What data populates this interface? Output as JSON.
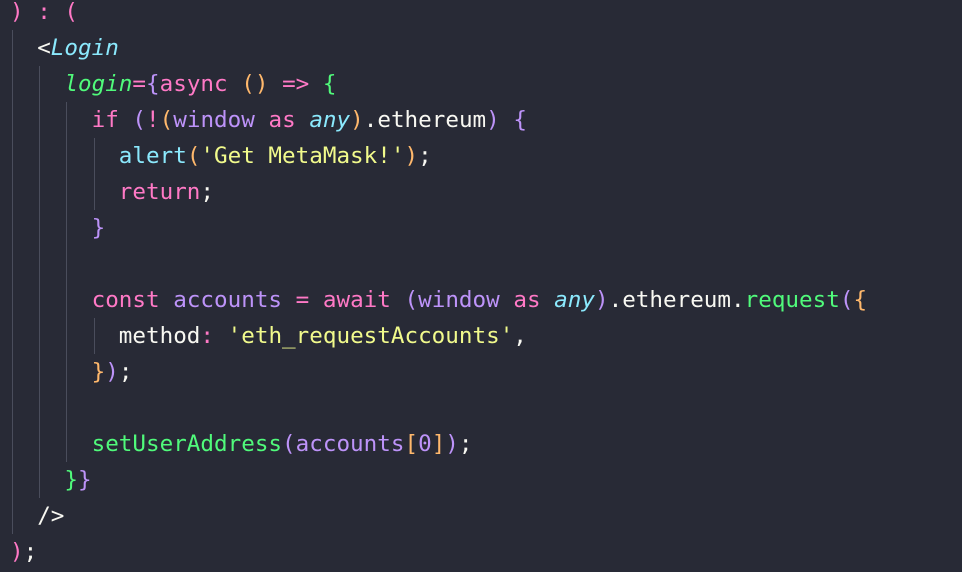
{
  "theme": {
    "background": "#282a36",
    "indent_guide": "#4a4d5c",
    "colors": {
      "punct": "#f8f8f2",
      "keyword": "#ff79c6",
      "identifier": "#bd93f9",
      "component": "#8be9fd",
      "prop": "#50fa7b",
      "function": "#50fa7b",
      "builtin": "#8be9fd",
      "string": "#f1fa8c",
      "paren_pink": "#ff79c6",
      "paren_purple": "#bd93f9",
      "paren_orange": "#ffb86c",
      "paren_green": "#50fa7b",
      "number": "#bd93f9",
      "tag_bracket": "#f8f8f2"
    }
  },
  "code": {
    "lines": [
      {
        "indent": 0,
        "tokens": [
          {
            "t": ") : (",
            "c": "paren_pink"
          }
        ]
      },
      {
        "indent": 1,
        "tokens": [
          {
            "t": "<",
            "c": "tag_bracket"
          },
          {
            "t": "Login",
            "c": "component",
            "i": true
          }
        ]
      },
      {
        "indent": 2,
        "tokens": [
          {
            "t": "login",
            "c": "prop",
            "i": true
          },
          {
            "t": "=",
            "c": "keyword"
          },
          {
            "t": "{",
            "c": "paren_purple"
          },
          {
            "t": "async",
            "c": "keyword"
          },
          {
            "t": " ",
            "c": "punct"
          },
          {
            "t": "()",
            "c": "paren_orange"
          },
          {
            "t": " ",
            "c": "punct"
          },
          {
            "t": "=>",
            "c": "keyword"
          },
          {
            "t": " ",
            "c": "punct"
          },
          {
            "t": "{",
            "c": "paren_green"
          }
        ]
      },
      {
        "indent": 3,
        "tokens": [
          {
            "t": "if",
            "c": "keyword"
          },
          {
            "t": " ",
            "c": "punct"
          },
          {
            "t": "(",
            "c": "paren_purple"
          },
          {
            "t": "!",
            "c": "keyword"
          },
          {
            "t": "(",
            "c": "paren_orange"
          },
          {
            "t": "window",
            "c": "identifier"
          },
          {
            "t": " ",
            "c": "punct"
          },
          {
            "t": "as",
            "c": "keyword"
          },
          {
            "t": " ",
            "c": "punct"
          },
          {
            "t": "any",
            "c": "component",
            "i": true
          },
          {
            "t": ")",
            "c": "paren_orange"
          },
          {
            "t": ".ethereum",
            "c": "punct"
          },
          {
            "t": ")",
            "c": "paren_purple"
          },
          {
            "t": " ",
            "c": "punct"
          },
          {
            "t": "{",
            "c": "paren_purple"
          }
        ]
      },
      {
        "indent": 4,
        "tokens": [
          {
            "t": "alert",
            "c": "builtin"
          },
          {
            "t": "(",
            "c": "paren_orange"
          },
          {
            "t": "'Get MetaMask!'",
            "c": "string"
          },
          {
            "t": ")",
            "c": "paren_orange"
          },
          {
            "t": ";",
            "c": "punct"
          }
        ]
      },
      {
        "indent": 4,
        "tokens": [
          {
            "t": "return",
            "c": "keyword"
          },
          {
            "t": ";",
            "c": "punct"
          }
        ]
      },
      {
        "indent": 3,
        "tokens": [
          {
            "t": "}",
            "c": "paren_purple"
          }
        ]
      },
      {
        "indent": 0,
        "tokens": []
      },
      {
        "indent": 3,
        "tokens": [
          {
            "t": "const",
            "c": "keyword"
          },
          {
            "t": " ",
            "c": "punct"
          },
          {
            "t": "accounts",
            "c": "identifier"
          },
          {
            "t": " ",
            "c": "punct"
          },
          {
            "t": "=",
            "c": "keyword"
          },
          {
            "t": " ",
            "c": "punct"
          },
          {
            "t": "await",
            "c": "keyword"
          },
          {
            "t": " ",
            "c": "punct"
          },
          {
            "t": "(",
            "c": "paren_purple"
          },
          {
            "t": "window",
            "c": "identifier"
          },
          {
            "t": " ",
            "c": "punct"
          },
          {
            "t": "as",
            "c": "keyword"
          },
          {
            "t": " ",
            "c": "punct"
          },
          {
            "t": "any",
            "c": "component",
            "i": true
          },
          {
            "t": ")",
            "c": "paren_purple"
          },
          {
            "t": ".ethereum.",
            "c": "punct"
          },
          {
            "t": "request",
            "c": "function"
          },
          {
            "t": "(",
            "c": "paren_purple"
          },
          {
            "t": "{",
            "c": "paren_orange"
          }
        ]
      },
      {
        "indent": 4,
        "tokens": [
          {
            "t": "method",
            "c": "punct"
          },
          {
            "t": ": ",
            "c": "keyword"
          },
          {
            "t": "'eth_requestAccounts'",
            "c": "string"
          },
          {
            "t": ",",
            "c": "punct"
          }
        ]
      },
      {
        "indent": 3,
        "tokens": [
          {
            "t": "}",
            "c": "paren_orange"
          },
          {
            "t": ")",
            "c": "paren_purple"
          },
          {
            "t": ";",
            "c": "punct"
          }
        ]
      },
      {
        "indent": 0,
        "tokens": []
      },
      {
        "indent": 3,
        "tokens": [
          {
            "t": "setUserAddress",
            "c": "function"
          },
          {
            "t": "(",
            "c": "paren_purple"
          },
          {
            "t": "accounts",
            "c": "identifier"
          },
          {
            "t": "[",
            "c": "paren_orange"
          },
          {
            "t": "0",
            "c": "number"
          },
          {
            "t": "]",
            "c": "paren_orange"
          },
          {
            "t": ")",
            "c": "paren_purple"
          },
          {
            "t": ";",
            "c": "punct"
          }
        ]
      },
      {
        "indent": 2,
        "tokens": [
          {
            "t": "}",
            "c": "paren_green"
          },
          {
            "t": "}",
            "c": "paren_purple"
          }
        ]
      },
      {
        "indent": 1,
        "tokens": [
          {
            "t": "/>",
            "c": "tag_bracket"
          }
        ]
      },
      {
        "indent": 0,
        "tokens": [
          {
            "t": ")",
            "c": "paren_pink"
          },
          {
            "t": ";",
            "c": "punct"
          }
        ]
      }
    ]
  }
}
